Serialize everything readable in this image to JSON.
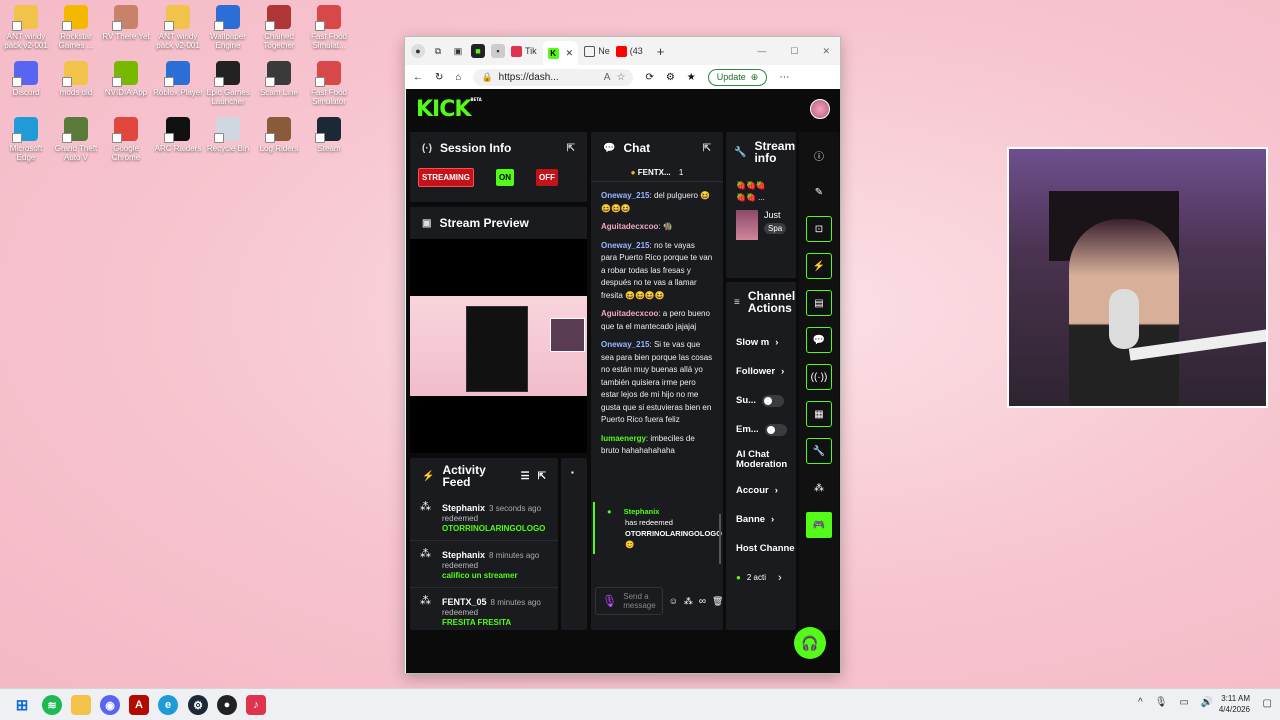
{
  "desktop": {
    "icons": [
      {
        "label": "ANT windy pack v2-001",
        "color": "#f2c34a"
      },
      {
        "label": "Rockstar Games ...",
        "color": "#f5b800"
      },
      {
        "label": "RV There Yet",
        "color": "#c9826a"
      },
      {
        "label": "ANT windy pack v2-001",
        "color": "#f2c34a"
      },
      {
        "label": "Wallpaper Engine",
        "color": "#2b6fd6"
      },
      {
        "label": "Chained Together",
        "color": "#b03636"
      },
      {
        "label": "Fast Food Simulat...",
        "color": "#d94848"
      },
      {
        "label": "Discord",
        "color": "#5865f2"
      },
      {
        "label": "mods old",
        "color": "#f2c34a"
      },
      {
        "label": "NVIDIA App",
        "color": "#76b900"
      },
      {
        "label": "Roblox Player",
        "color": "#2b6fd6"
      },
      {
        "label": "Epic Games Launcher",
        "color": "#222222"
      },
      {
        "label": "Scam Line",
        "color": "#3a3a3a"
      },
      {
        "label": "Fast Food Simulator",
        "color": "#d94848"
      },
      {
        "label": "Microsoft Edge",
        "color": "#1f9cd8"
      },
      {
        "label": "Grand Theft Auto V",
        "color": "#5a7a3a"
      },
      {
        "label": "Google Chrome",
        "color": "#e0463b"
      },
      {
        "label": "ARC Raiders",
        "color": "#111111"
      },
      {
        "label": "Recycle Bin",
        "color": "#cfd8e0"
      },
      {
        "label": "Log Riders",
        "color": "#8a5a3a"
      },
      {
        "label": "Steam",
        "color": "#1b2838"
      }
    ]
  },
  "browser": {
    "tabs": [
      {
        "label": "Tik",
        "color": "#e0334f"
      },
      {
        "label": "",
        "color": "#53fc18",
        "active": true
      },
      {
        "label": "Ne",
        "color": "#555555"
      },
      {
        "label": "(43",
        "color": "#ff0000"
      }
    ],
    "url": "https://dash...",
    "update_label": "Update"
  },
  "kick": {
    "logo": "KICK",
    "logo_sup": "BETA",
    "session": {
      "title": "Session Info",
      "streaming": "STREAMING",
      "on": "ON",
      "off": "OFF"
    },
    "preview": {
      "title": "Stream Preview"
    },
    "chat": {
      "title": "Chat",
      "pinned_user": "FENTX...",
      "pinned_count": "1",
      "messages": [
        {
          "user": "Oneway_215",
          "color": "#9ab8ff",
          "text": "del pulguero 😆😆😆😆"
        },
        {
          "user": "Aguitadecxcoo",
          "color": "#f3a6c1",
          "text": "🧌"
        },
        {
          "user": "Oneway_215",
          "color": "#9ab8ff",
          "text": "no te vayas para Puerto Rico porque te van a robar todas las fresas y después no te vas a llamar fresita 😆😆😆😆"
        },
        {
          "user": "Aguitadecxcoo",
          "color": "#f3a6c1",
          "text": "a pero bueno que ta el mantecado jajajaj"
        },
        {
          "user": "Oneway_215",
          "color": "#9ab8ff",
          "text": "Si te vas que sea para bien porque las cosas no están muy buenas allá yo también quisiera irme pero estar lejos de mi hijo no me gusta que si estuvieras bien en Puerto Rico fuera feliz"
        },
        {
          "user": "lumaenergy",
          "color": "#53fc18",
          "text": "imbeciles de bruto hahahahahaha"
        }
      ],
      "redeem": {
        "user": "Stephanix",
        "text": "has redeemed",
        "reward": "OTORRINOLARINGOLOGO",
        "emoji": "😊"
      },
      "input_placeholder": "Send a message"
    },
    "activity": {
      "title": "Activity Feed",
      "items": [
        {
          "user": "Stephanix",
          "time": "3 seconds ago",
          "verb": "redeemed",
          "reward": "OTORRINOLARINGOLOGO"
        },
        {
          "user": "Stephanix",
          "time": "8 minutes ago",
          "verb": "redeemed",
          "reward": "califico un streamer"
        },
        {
          "user": "FENTX_05",
          "time": "8 minutes ago",
          "verb": "redeemed",
          "reward": "FRESITA FRESITA"
        }
      ]
    },
    "stream_info": {
      "title": "Stream info",
      "emojis": "🍓🍓🍓 🍓🍓 ...",
      "just": "Just",
      "spa": "Spa"
    },
    "channel_actions": {
      "title": "Channel Actions",
      "slow": "Slow m",
      "followers": "Follower",
      "subs": "Su...",
      "emotes": "Em...",
      "ai": "AI Chat Moderation",
      "account": "Accour",
      "banned": "Banne",
      "host": "Host Channe",
      "active": "2 acti"
    }
  },
  "taskbar": {
    "time": "3:11 AM",
    "date": "4/4/2026"
  }
}
